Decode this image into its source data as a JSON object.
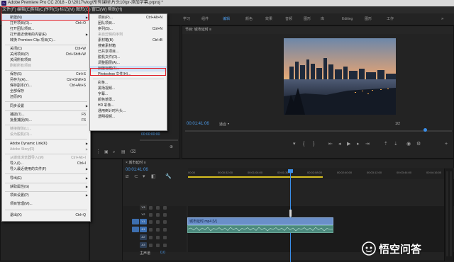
{
  "title_bar": {
    "title": "Adobe Premiere Pro CC 2018 - D:\\2017\\vlog\\所有课程\\片头10\\pr-添加字幕.prproj *",
    "app_icon": "Pr"
  },
  "menu_bar": {
    "items": [
      "文件(F)",
      "编辑(E)",
      "剪辑(C)",
      "序列(S)",
      "标记(M)",
      "图形(G)",
      "窗口(W)",
      "帮助(H)"
    ]
  },
  "workspace": {
    "tabs": [
      "学习",
      "组件",
      "编辑",
      "颜色",
      "效果",
      "音频",
      "图形",
      "库",
      "Editing",
      "图形",
      "工作"
    ],
    "active_index": 2
  },
  "file_menu": {
    "items": [
      {
        "label": "新建(N)",
        "shortcut": "",
        "arrow": true,
        "disabled": false
      },
      {
        "label": "打开项目(O)...",
        "shortcut": "Ctrl+O",
        "arrow": false,
        "disabled": false
      },
      {
        "label": "打开团队项目...",
        "shortcut": "",
        "arrow": false,
        "disabled": false
      },
      {
        "label": "打开最近使用的内容(E)",
        "shortcut": "",
        "arrow": true,
        "disabled": false
      },
      {
        "label": "转换 Premiere Clip 项目(C)...",
        "shortcut": "",
        "arrow": false,
        "disabled": false
      },
      {
        "label": "关闭(C)",
        "shortcut": "Ctrl+W",
        "arrow": false,
        "disabled": false
      },
      {
        "label": "关闭项目(P)",
        "shortcut": "Ctrl+Shift+W",
        "arrow": false,
        "disabled": false
      },
      {
        "label": "关闭所有项目",
        "shortcut": "",
        "arrow": false,
        "disabled": false
      },
      {
        "label": "刷新所有项目",
        "shortcut": "",
        "arrow": false,
        "disabled": true
      },
      {
        "label": "保存(S)",
        "shortcut": "Ctrl+S",
        "arrow": false,
        "disabled": false
      },
      {
        "label": "另存为(A)...",
        "shortcut": "Ctrl+Shift+S",
        "arrow": false,
        "disabled": false
      },
      {
        "label": "保存副本(Y)...",
        "shortcut": "Ctrl+Alt+S",
        "arrow": false,
        "disabled": false
      },
      {
        "label": "全部保存",
        "shortcut": "",
        "arrow": false,
        "disabled": false
      },
      {
        "label": "还原(R)",
        "shortcut": "",
        "arrow": false,
        "disabled": false
      },
      {
        "label": "同步设置",
        "shortcut": "",
        "arrow": true,
        "disabled": false
      },
      {
        "label": "捕捉(T)...",
        "shortcut": "F5",
        "arrow": false,
        "disabled": false
      },
      {
        "label": "批量捕捉(B)...",
        "shortcut": "F6",
        "arrow": false,
        "disabled": false
      },
      {
        "label": "链接媒体(L)...",
        "shortcut": "",
        "arrow": false,
        "disabled": true
      },
      {
        "label": "设为脱机(O)...",
        "shortcut": "",
        "arrow": false,
        "disabled": true
      },
      {
        "label": "Adobe Dynamic Link(K)",
        "shortcut": "",
        "arrow": true,
        "disabled": false
      },
      {
        "label": "Adobe Story(R)",
        "shortcut": "",
        "arrow": true,
        "disabled": true
      },
      {
        "label": "从媒体浏览器导入(M)",
        "shortcut": "Ctrl+Alt+I",
        "arrow": false,
        "disabled": true
      },
      {
        "label": "导入(I)...",
        "shortcut": "Ctrl+I",
        "arrow": false,
        "disabled": false
      },
      {
        "label": "导入最近使用的文件(F)",
        "shortcut": "",
        "arrow": true,
        "disabled": false
      },
      {
        "label": "导出(E)",
        "shortcut": "",
        "arrow": true,
        "disabled": false
      },
      {
        "label": "获取属性(G)",
        "shortcut": "",
        "arrow": true,
        "disabled": false
      },
      {
        "label": "项目设置(P)",
        "shortcut": "",
        "arrow": true,
        "disabled": false
      },
      {
        "label": "项目管理(M)...",
        "shortcut": "",
        "arrow": false,
        "disabled": false
      },
      {
        "label": "退出(X)",
        "shortcut": "Ctrl+Q",
        "arrow": false,
        "disabled": false
      }
    ]
  },
  "new_submenu": {
    "items": [
      {
        "label": "项目(P)...",
        "shortcut": "Ctrl+Alt+N",
        "disabled": false
      },
      {
        "label": "团队项目...",
        "shortcut": "",
        "disabled": false
      },
      {
        "label": "序列(S)...",
        "shortcut": "Ctrl+N",
        "disabled": false
      },
      {
        "label": "来自剪辑的序列",
        "shortcut": "",
        "disabled": true
      },
      {
        "label": "素材箱(B)",
        "shortcut": "Ctrl+B",
        "disabled": false
      },
      {
        "label": "搜索素材箱",
        "shortcut": "",
        "disabled": false
      },
      {
        "label": "已共享项目...",
        "shortcut": "",
        "disabled": false
      },
      {
        "label": "脱机文件(O)...",
        "shortcut": "",
        "disabled": false
      },
      {
        "label": "调整图层(A)...",
        "shortcut": "",
        "disabled": false
      },
      {
        "label": "旧版标题(T)...",
        "shortcut": "",
        "disabled": false
      },
      {
        "label": "Photoshop 文件(H)...",
        "shortcut": "",
        "disabled": false
      },
      {
        "label": "彩条...",
        "shortcut": "",
        "disabled": false
      },
      {
        "label": "黑场视频...",
        "shortcut": "",
        "disabled": false
      },
      {
        "label": "字幕...",
        "shortcut": "",
        "disabled": false
      },
      {
        "label": "颜色遮罩...",
        "shortcut": "",
        "disabled": false
      },
      {
        "label": "HD 彩条...",
        "shortcut": "",
        "disabled": false
      },
      {
        "label": "通用倒计时片头...",
        "shortcut": "",
        "disabled": false
      },
      {
        "label": "透明视频...",
        "shortcut": "",
        "disabled": false
      }
    ],
    "highlighted_index": 9
  },
  "program_monitor": {
    "header": "节目: 城市延时  ≡",
    "timecode": "00:01:41:06",
    "fit_label": "适合",
    "total_time": "1/2"
  },
  "source_monitor": {
    "timecode": "00:00:00:00"
  },
  "timeline": {
    "header": "×  城市延时  ≡",
    "timecode": "00:01:41:06",
    "ruler_ticks": [
      "00:00",
      "00:00:32:00",
      "00:01:04:00",
      "00:01:36:00",
      "00:02:08:00",
      "00:02:40:00",
      "00:03:12:00",
      "00:03:44:00",
      "00:04:16:00"
    ],
    "video_tracks": [
      "V3",
      "V2",
      "V1"
    ],
    "audio_tracks": [
      "A1",
      "A2",
      "A3"
    ],
    "master_label": "主声道",
    "master_value": "0.0",
    "clip_name": "城市延时.mp4 [V]",
    "colors": {
      "clip": "#6a8fc9",
      "audio_clip": "#4c8a7d",
      "playhead": "#3a8ee8"
    }
  },
  "watermark": {
    "text": "悟空问答"
  }
}
